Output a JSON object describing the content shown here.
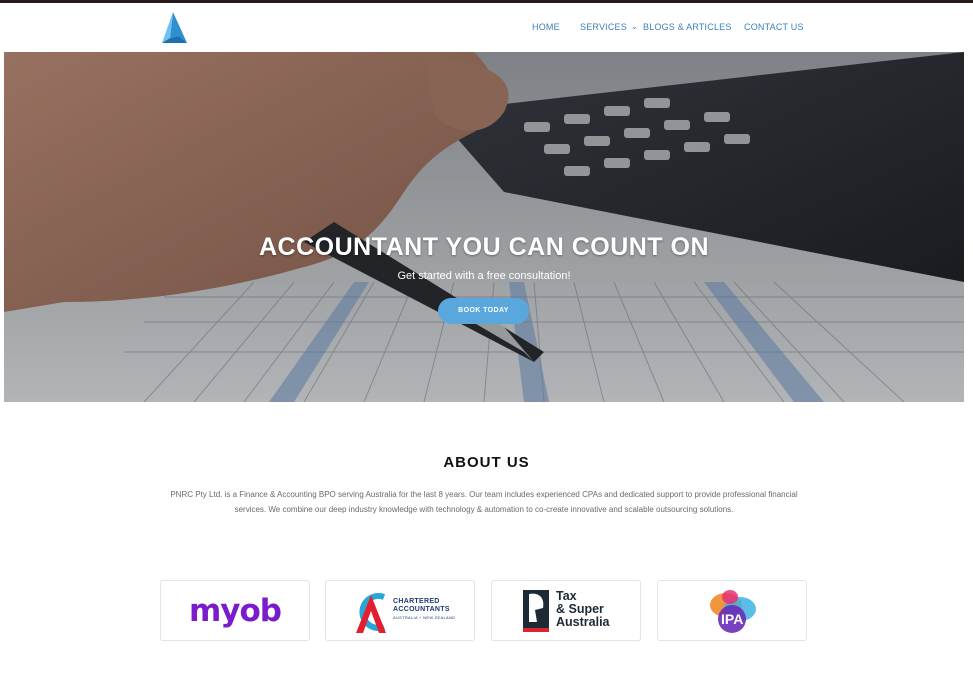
{
  "nav": {
    "logo_icon": "triangle-a-logo",
    "items": [
      {
        "label": "HOME"
      },
      {
        "label": "SERVICES",
        "icon": "chevron-down-icon"
      },
      {
        "label": "BLOGS & ARTICLES"
      },
      {
        "label": "CONTACT US"
      }
    ]
  },
  "hero": {
    "title": "ACCOUNTANT YOU CAN COUNT ON",
    "subtitle": "Get started with a free consultation!",
    "button_label": "BOOK TODAY",
    "button_color": "#5aa7dd"
  },
  "about": {
    "title": "ABOUT US",
    "text": "PNRC Pty Ltd. is a Finance & Accounting BPO serving Australia for the last 8 years. Our team includes experienced CPAs and dedicated support to provide professional financial services. We combine our deep industry knowledge with technology & automation to co-create innovative and scalable outsourcing solutions."
  },
  "partners": [
    {
      "name": "myob",
      "color": "#7a1ccc"
    },
    {
      "line1": "CHARTERED",
      "line2": "ACCOUNTANTS",
      "sub": "AUSTRALIA + NEW ZEALAND"
    },
    {
      "line1": "Tax",
      "line2": "& Super",
      "line3": "Australia"
    },
    {
      "name": "IPA"
    }
  ],
  "colors": {
    "nav_link": "#3d7fb5",
    "accent": "#5aa7dd"
  }
}
